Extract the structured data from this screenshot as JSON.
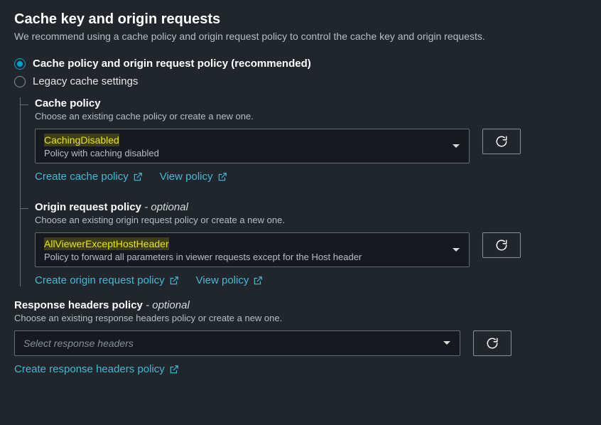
{
  "header": {
    "title": "Cache key and origin requests",
    "description": "We recommend using a cache policy and origin request policy to control the cache key and origin requests."
  },
  "radios": {
    "recommended_label": "Cache policy and origin request policy (recommended)",
    "legacy_label": "Legacy cache settings"
  },
  "cache_policy": {
    "title": "Cache policy",
    "description": "Choose an existing cache policy or create a new one.",
    "selected_value": "CachingDisabled",
    "selected_sub": "Policy with caching disabled",
    "create_link": "Create cache policy",
    "view_link": "View policy"
  },
  "origin_policy": {
    "title_prefix": "Origin request policy",
    "optional_suffix": " - optional",
    "description": "Choose an existing origin request policy or create a new one.",
    "selected_value": "AllViewerExceptHostHeader",
    "selected_sub": "Policy to forward all parameters in viewer requests except for the Host header",
    "create_link": "Create origin request policy",
    "view_link": "View policy"
  },
  "response_policy": {
    "title_prefix": "Response headers policy",
    "optional_suffix": " - optional",
    "description": "Choose an existing response headers policy or create a new one.",
    "placeholder": "Select response headers",
    "create_link": "Create response headers policy"
  }
}
